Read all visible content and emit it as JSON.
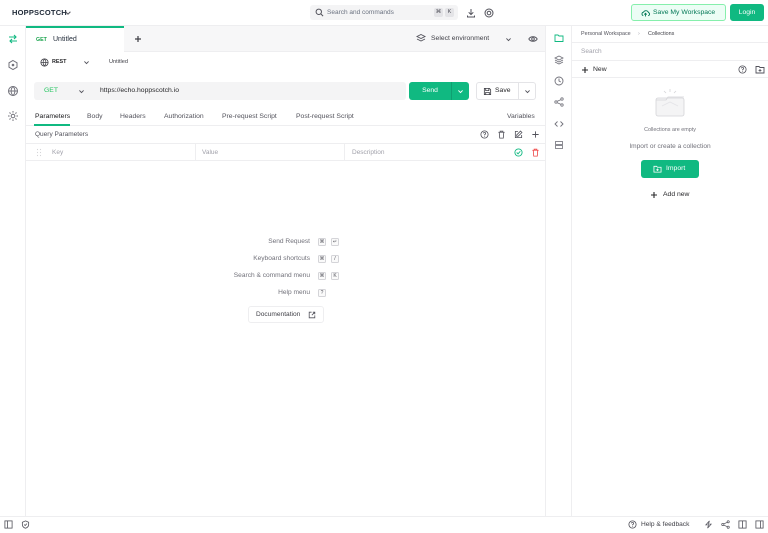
{
  "app": {
    "brand": "HOPPSCOTCH",
    "search_placeholder": "Search and commands",
    "search_keys": [
      "⌘",
      "K"
    ],
    "save_workspace": "Save My Workspace",
    "login": "Login"
  },
  "tabs": [
    {
      "method": "GET",
      "title": "Untitled"
    }
  ],
  "environment": {
    "label": "Select environment"
  },
  "request": {
    "protocol": "REST",
    "name": "Untitled",
    "method": "GET",
    "url": "https://echo.hoppscotch.io",
    "send_label": "Send",
    "save_label": "Save"
  },
  "request_tabs": [
    "Parameters",
    "Body",
    "Headers",
    "Authorization",
    "Pre-request Script",
    "Post-request Script"
  ],
  "variables_label": "Variables",
  "query_params": {
    "title": "Query Parameters",
    "key_placeholder": "Key",
    "value_placeholder": "Value",
    "description_placeholder": "Description"
  },
  "shortcuts": [
    {
      "label": "Send Request",
      "keys": [
        "⌘",
        "↵"
      ]
    },
    {
      "label": "Keyboard shortcuts",
      "keys": [
        "⌘",
        "/"
      ]
    },
    {
      "label": "Search & command menu",
      "keys": [
        "⌘",
        "K"
      ]
    },
    {
      "label": "Help menu",
      "keys": [
        "?"
      ]
    }
  ],
  "documentation_label": "Documentation",
  "collections": {
    "breadcrumb_workspace": "Personal Workspace",
    "breadcrumb_sep": "›",
    "breadcrumb_current": "Collections",
    "search_placeholder": "Search",
    "new_label": "New",
    "empty_text": "Collections are empty",
    "import_hint": "Import or create a collection",
    "import_label": "Import",
    "add_new_label": "Add new"
  },
  "footer": {
    "help_feedback": "Help & feedback"
  },
  "colors": {
    "accent": "#10b981",
    "get_method": "#22c55e"
  }
}
